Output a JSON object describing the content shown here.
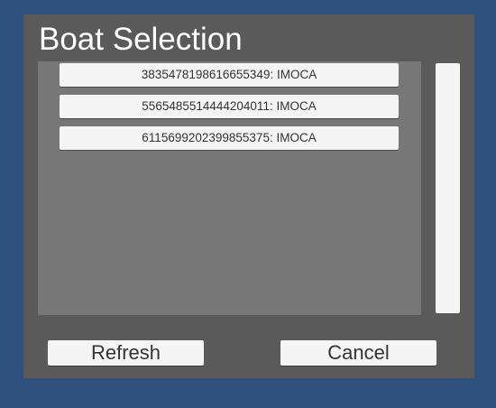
{
  "dialog": {
    "title": "Boat Selection",
    "boats": [
      {
        "label": "3835478198616655349: IMOCA"
      },
      {
        "label": "5565485514444204011: IMOCA"
      },
      {
        "label": "6115699202399855375: IMOCA"
      }
    ],
    "refresh_label": "Refresh",
    "cancel_label": "Cancel"
  },
  "colors": {
    "background": "#2f4f7e",
    "dialog": "#5a5a5a",
    "list_panel": "#777777",
    "button": "#f4f4f4"
  }
}
